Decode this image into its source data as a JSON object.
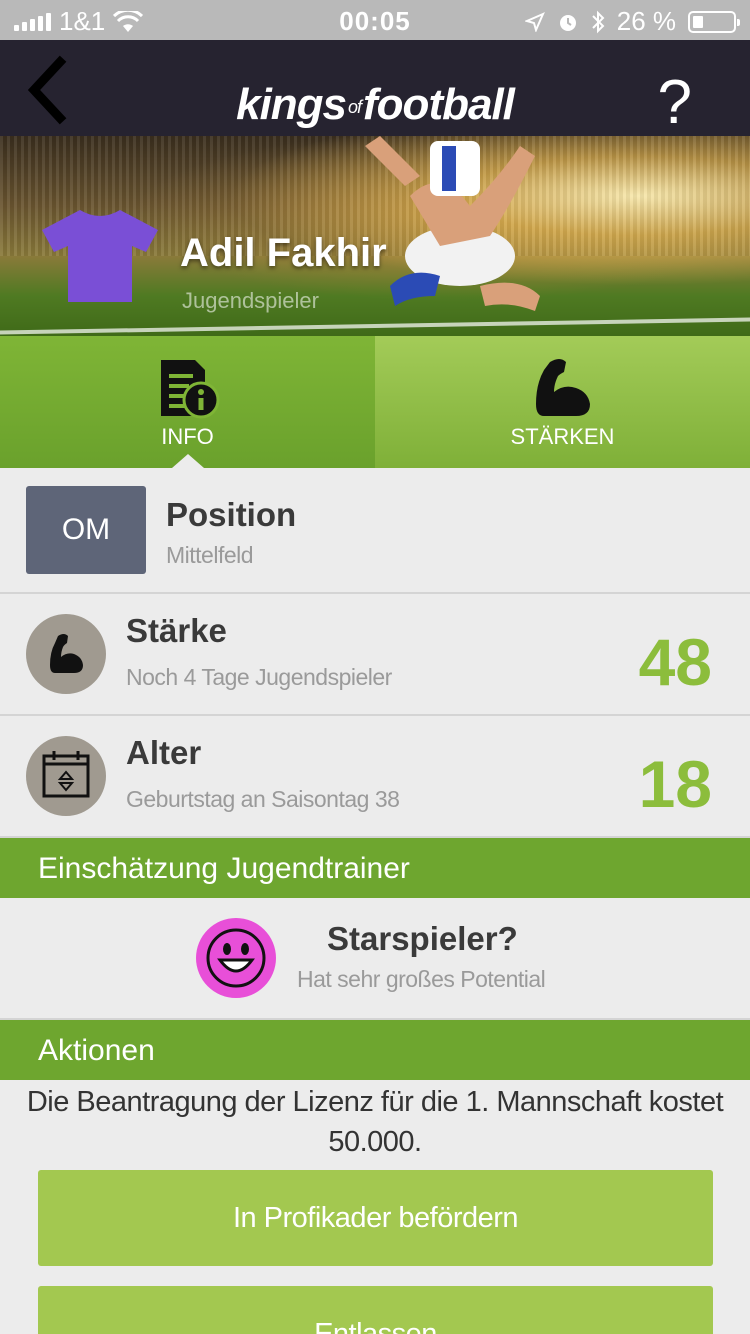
{
  "status_bar": {
    "carrier": "1&1",
    "time": "00:05",
    "battery": "26 %"
  },
  "nav": {
    "logo_word1": "kings",
    "logo_of": "of",
    "logo_word2": "football",
    "help_label": "?",
    "back_icon": "chevron-left-icon"
  },
  "player": {
    "name": "Adil Fakhir",
    "role": "Jugendspieler",
    "jersey_color": "#7a4fd6"
  },
  "tabs": [
    {
      "label": "INFO",
      "icon": "document-info-icon",
      "active": true
    },
    {
      "label": "STÄRKEN",
      "icon": "flexed-bicep-icon",
      "active": false
    }
  ],
  "position": {
    "badge": "OM",
    "title": "Position",
    "subtitle": "Mittelfeld"
  },
  "strength": {
    "title": "Stärke",
    "subtitle": "Noch 4 Tage Jugendspieler",
    "value": "48"
  },
  "age": {
    "title": "Alter",
    "subtitle": "Geburtstag an Saisontag 38",
    "value": "18"
  },
  "assessment": {
    "header": "Einschätzung Jugendtrainer",
    "title": "Starspieler?",
    "subtitle": "Hat sehr großes Potential",
    "smiley_color": "#e84fd8"
  },
  "actions": {
    "header": "Aktionen",
    "text": "Die Beantragung der Lizenz für die 1. Mannschaft kostet 50.000.",
    "promote_button": "In Profikader befördern",
    "dismiss_button": "Entlassen"
  },
  "colors": {
    "nav_bg": "#262330",
    "accent_green": "#6ea62f",
    "value_green": "#8cbd3c",
    "button_green": "#a3c850"
  }
}
